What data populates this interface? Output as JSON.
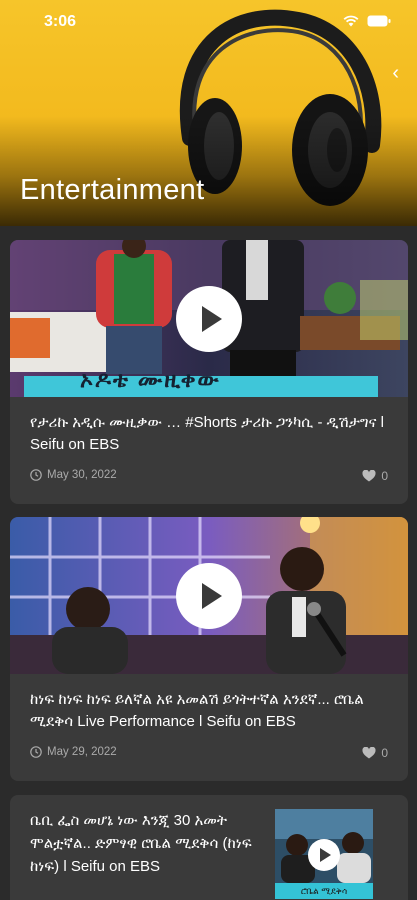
{
  "status": {
    "time": "3:06"
  },
  "header": {
    "title": "Entertainment"
  },
  "colors": {
    "hero": "#f2b81c",
    "background": "#2b2b2b",
    "card": "#3a3a3a",
    "meta": "#aaaaaa",
    "banner": "#34c3d6"
  },
  "videos": [
    {
      "title": "የታሪኩ አዲሱ ሙዚቃው … #Shorts ታሪኩ ጋንካሲ - ዲሽታግና l Seifu on EBS",
      "date": "May 30, 2022",
      "likes": "0",
      "thumb_banner": "ኦዶቴ ሙዚቀው"
    },
    {
      "title": "ከነፍ ከነፍ ከነፍ ይለኛል አዩ አመልሽ ይጎትተኛል አንደኛ... ሮቤል ሚደቅሳ Live Performance l Seifu on EBS",
      "date": "May 29, 2022",
      "likes": "0"
    },
    {
      "title": "ቤቢ ፌስ መሆኔ ነው እንጂ 30 አመት ሞልቷኛል.. ድምፃዊ ሮቤል ሚደቅሳ (ከነፍ ከነፍ) l Seifu on EBS",
      "thumb_caption": "ሮቤል ሚደቅሳ"
    }
  ]
}
